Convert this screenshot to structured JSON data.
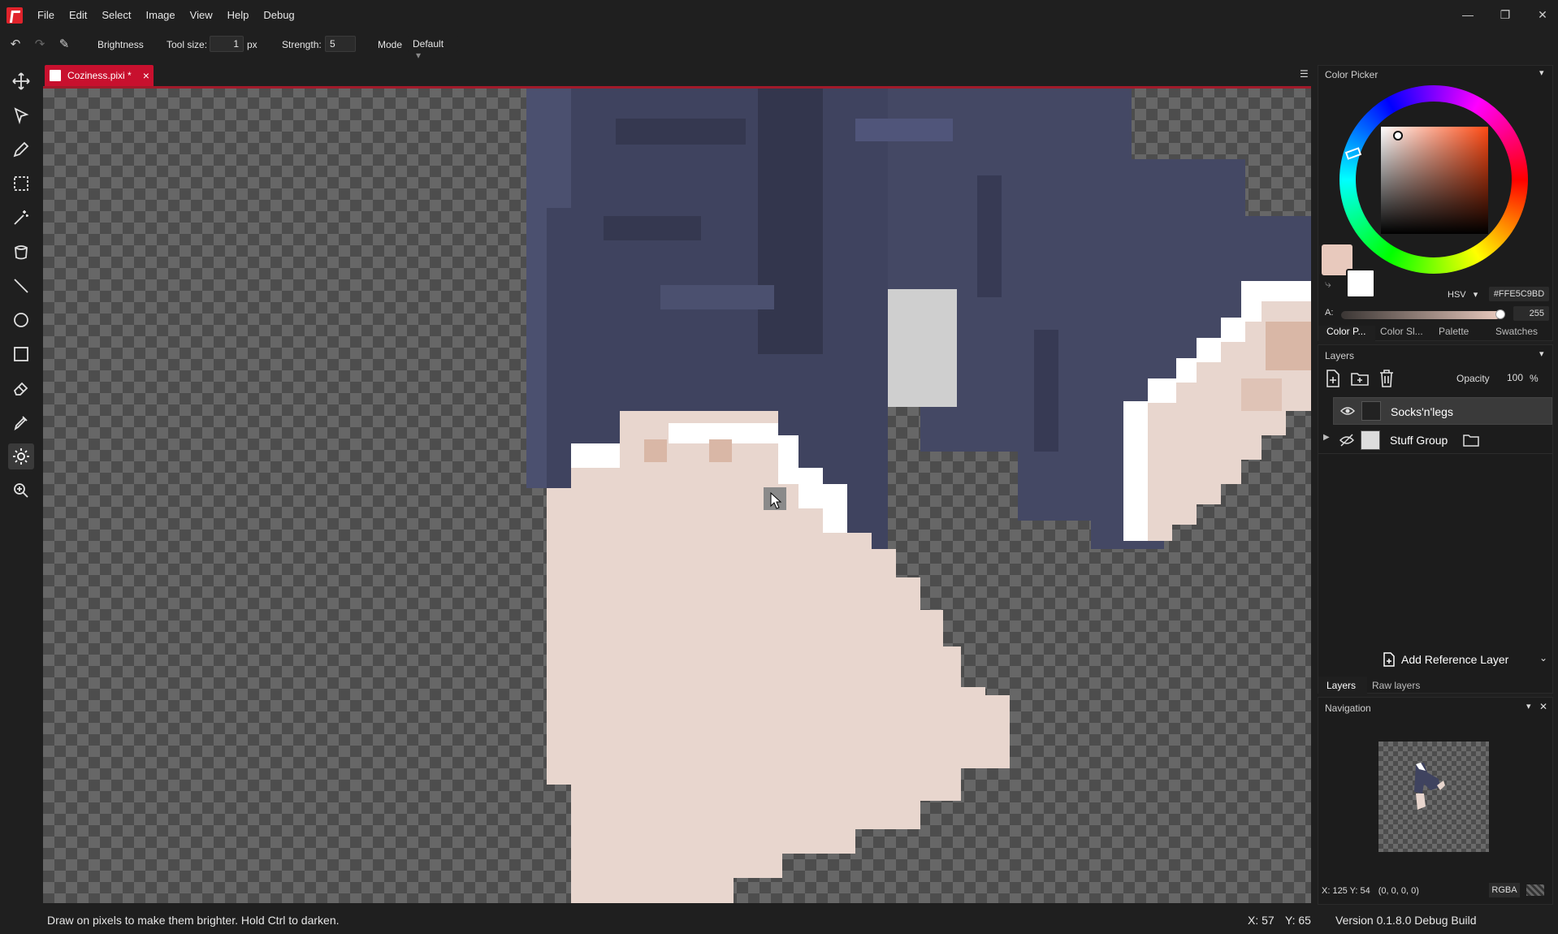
{
  "menu": [
    "File",
    "Edit",
    "Select",
    "Image",
    "View",
    "Help",
    "Debug"
  ],
  "window": {
    "minimize": "—",
    "restore": "❐",
    "close": "✕"
  },
  "toolbar": {
    "tool_name": "Brightness",
    "tool_size_label": "Tool size:",
    "tool_size_value": "1",
    "tool_size_unit": "px",
    "strength_label": "Strength:",
    "strength_value": "5",
    "mode_label": "Mode",
    "mode_value": "Default"
  },
  "tools": [
    "move-icon",
    "select-arrow-icon",
    "pen-icon",
    "rectangle-select-icon",
    "magic-wand-icon",
    "bucket-icon",
    "line-icon",
    "ellipse-icon",
    "rectangle-icon",
    "eraser-icon",
    "color-picker-icon",
    "brightness-icon",
    "zoom-icon"
  ],
  "document": {
    "tab_title": "Coziness.pixi *",
    "close": "×"
  },
  "color_picker": {
    "title": "Color Picker",
    "color_model": "HSV",
    "hex": "#FFE5C9BD",
    "alpha_label": "A:",
    "alpha_value": "255",
    "tabs": [
      "Color P...",
      "Color Sl...",
      "Palette",
      "Swatches"
    ],
    "primary_color": "#e8c9bd",
    "secondary_color": "#ffffff"
  },
  "layers": {
    "title": "Layers",
    "opacity_label": "Opacity",
    "opacity_value": "100",
    "opacity_unit": "%",
    "items": [
      {
        "name": "Socks'n'legs",
        "visible": true,
        "selected": true
      },
      {
        "name": "Stuff Group",
        "visible": false,
        "selected": false
      }
    ],
    "add_reference": "Add Reference Layer",
    "tabs": [
      "Layers",
      "Raw layers"
    ]
  },
  "navigation": {
    "title": "Navigation",
    "readout": "X: 125 Y: 54",
    "pixel_value": "(0, 0, 0, 0)",
    "channel": "RGBA"
  },
  "status": {
    "hint": "Draw on pixels to make them brighter. Hold Ctrl to darken.",
    "cursor_x": "X: 57",
    "cursor_y": "Y: 65",
    "version": "Version 0.1.8.0 Debug Build"
  },
  "colors": {
    "accent": "#c8102e",
    "sock_dark": "#3b3f5c",
    "sock_mid": "#4a4f6d",
    "skin": "#e8d6ce",
    "skin_shade": "#d9b7a6",
    "white": "#ffffff"
  }
}
